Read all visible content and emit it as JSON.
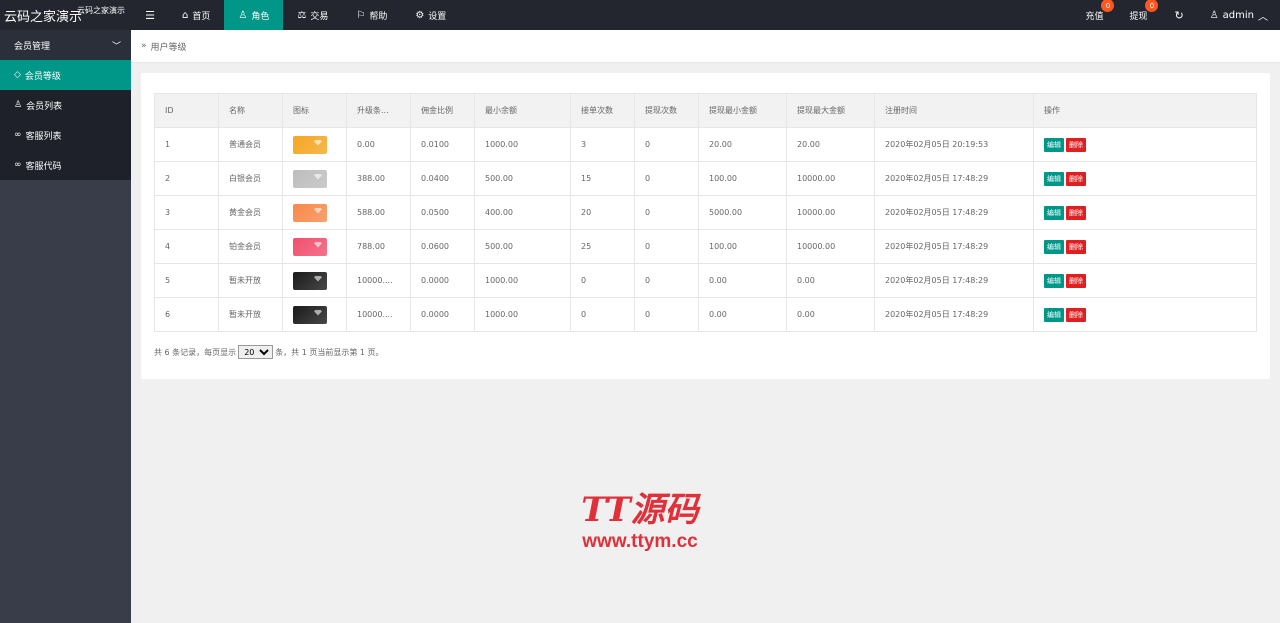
{
  "header": {
    "logo_main": "云码之家演示",
    "logo_sub": "云码之家演示",
    "nav": [
      {
        "label": "首页",
        "icon": "home-icon"
      },
      {
        "label": "角色",
        "icon": "user-icon"
      },
      {
        "label": "交易",
        "icon": "scale-icon"
      },
      {
        "label": "帮助",
        "icon": "flag-icon"
      },
      {
        "label": "设置",
        "icon": "gear-icon"
      }
    ],
    "recharge": "充值",
    "recharge_badge": "0",
    "withdraw": "提现",
    "withdraw_badge": "0",
    "username": "admin"
  },
  "sidebar": {
    "group": "会员管理",
    "items": [
      {
        "label": "会员等级",
        "icon": "diamond-icon"
      },
      {
        "label": "会员列表",
        "icon": "user-icon"
      },
      {
        "label": "客服列表",
        "icon": "link-icon"
      },
      {
        "label": "客服代码",
        "icon": "link-icon"
      }
    ]
  },
  "breadcrumb": "用户等级",
  "table": {
    "headers": [
      "ID",
      "名称",
      "图标",
      "升级条...",
      "佣金比例",
      "最小余额",
      "接单次数",
      "提现次数",
      "提现最小金额",
      "提现最大金额",
      "注册时间",
      "操作"
    ],
    "rows": [
      [
        "1",
        "普通会员",
        "#f5a623",
        "0.00",
        "0.0100",
        "1000.00",
        "3",
        "0",
        "20.00",
        "20.00",
        "2020年02月05日 20:19:53"
      ],
      [
        "2",
        "白银会员",
        "#bdbdbd",
        "388.00",
        "0.0400",
        "500.00",
        "15",
        "0",
        "100.00",
        "10000.00",
        "2020年02月05日 17:48:29"
      ],
      [
        "3",
        "黄金会员",
        "#f7894a",
        "588.00",
        "0.0500",
        "400.00",
        "20",
        "0",
        "5000.00",
        "10000.00",
        "2020年02月05日 17:48:29"
      ],
      [
        "4",
        "铂金会员",
        "#f0506e",
        "788.00",
        "0.0600",
        "500.00",
        "25",
        "0",
        "100.00",
        "10000.00",
        "2020年02月05日 17:48:29"
      ],
      [
        "5",
        "暂未开放",
        "#1a1a1a",
        "10000....",
        "0.0000",
        "1000.00",
        "0",
        "0",
        "0.00",
        "0.00",
        "2020年02月05日 17:48:29"
      ],
      [
        "6",
        "暂未开放",
        "#1a1a1a",
        "10000....",
        "0.0000",
        "1000.00",
        "0",
        "0",
        "0.00",
        "0.00",
        "2020年02月05日 17:48:29"
      ]
    ],
    "edit_label": "编辑",
    "delete_label": "删除"
  },
  "pager": {
    "prefix": "共 6 条记录，每页显示",
    "page_size": "20",
    "suffix": "条，共 1 页当前显示第 1 页。"
  },
  "watermark": {
    "big": "TT源码",
    "small": "www.ttym.cc"
  }
}
